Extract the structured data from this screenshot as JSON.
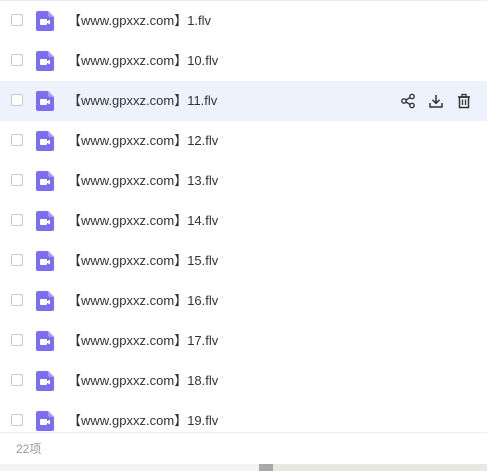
{
  "file_list": {
    "rows": [
      {
        "name": "【www.gpxxz.com】1.flv"
      },
      {
        "name": "【www.gpxxz.com】10.flv"
      },
      {
        "name": "【www.gpxxz.com】11.flv"
      },
      {
        "name": "【www.gpxxz.com】12.flv"
      },
      {
        "name": "【www.gpxxz.com】13.flv"
      },
      {
        "name": "【www.gpxxz.com】14.flv"
      },
      {
        "name": "【www.gpxxz.com】15.flv"
      },
      {
        "name": "【www.gpxxz.com】16.flv"
      },
      {
        "name": "【www.gpxxz.com】17.flv"
      },
      {
        "name": "【www.gpxxz.com】18.flv"
      },
      {
        "name": "【www.gpxxz.com】19.flv"
      }
    ],
    "hovered_row_index": 2,
    "row_actions": {
      "share_icon": "share-icon",
      "download_icon": "download-icon",
      "delete_icon": "trash-icon"
    },
    "file_icon": "video-file-icon"
  },
  "footer": {
    "count_label": "22项"
  },
  "colors": {
    "accent": "#7b6ff0",
    "hover_bg": "#eef2fd",
    "text": "#333333",
    "muted_text": "#999999"
  }
}
